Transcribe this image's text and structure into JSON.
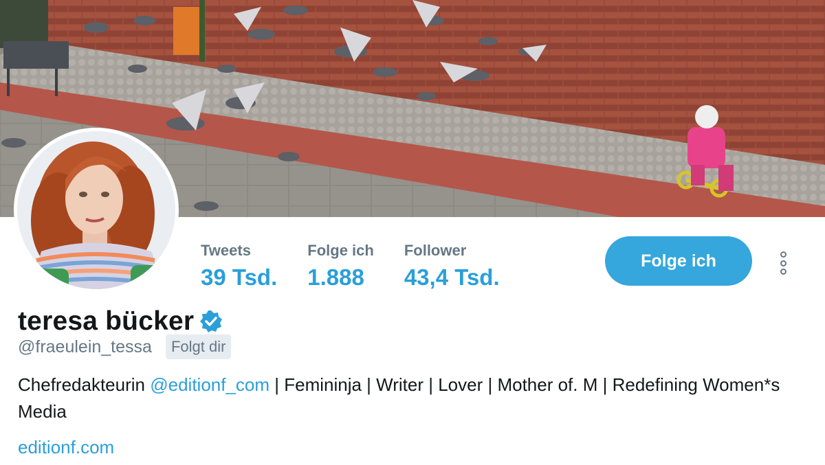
{
  "profile": {
    "name": "teresa bücker",
    "handle": "@fraeulein_tessa",
    "follows_you_badge": "Folgt dir",
    "verified": true,
    "bio": {
      "prefix": "Chefredakteurin ",
      "mention": "@editionf_com",
      "suffix": " | Femininja | Writer | Lover | Mother of. M | Redefining Women*s Media"
    },
    "website": "editionf.com"
  },
  "stats": [
    {
      "label": "Tweets",
      "value": "39 Tsd."
    },
    {
      "label": "Folge ich",
      "value": "1.888"
    },
    {
      "label": "Follower",
      "value": "43,4 Tsd."
    }
  ],
  "actions": {
    "follow_button": "Folge ich",
    "more_icon": "more-vertical-icon"
  },
  "colors": {
    "accent": "#2a9fd9",
    "button": "#35a7dc",
    "muted": "#657786",
    "text": "#14171a"
  }
}
